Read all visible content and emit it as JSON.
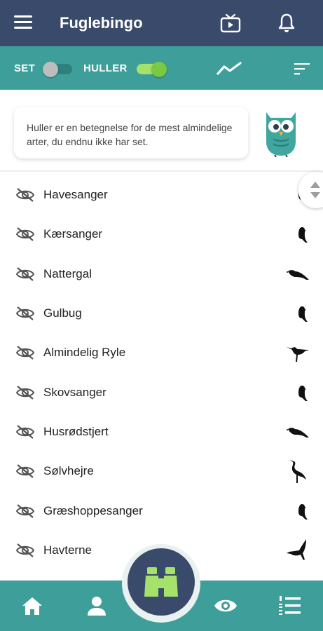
{
  "app": {
    "title": "Fuglebingo"
  },
  "filters": {
    "seen_label": "SET",
    "seen_on": false,
    "gaps_label": "HULLER",
    "gaps_on": true
  },
  "info": {
    "text": "Huller er en betegnelse for de mest almindelige arter, du endnu ikke har set."
  },
  "birds": [
    {
      "name": "Havesanger",
      "icon": "songbird-silhouette"
    },
    {
      "name": "Kærsanger",
      "icon": "songbird-silhouette"
    },
    {
      "name": "Nattergal",
      "icon": "thrush-silhouette"
    },
    {
      "name": "Gulbug",
      "icon": "songbird-silhouette"
    },
    {
      "name": "Almindelig Ryle",
      "icon": "wader-silhouette"
    },
    {
      "name": "Skovsanger",
      "icon": "songbird-silhouette"
    },
    {
      "name": "Husrødstjert",
      "icon": "thrush-silhouette"
    },
    {
      "name": "Sølvhejre",
      "icon": "heron-silhouette"
    },
    {
      "name": "Græshoppesanger",
      "icon": "songbird-silhouette"
    },
    {
      "name": "Havterne",
      "icon": "tern-silhouette"
    }
  ],
  "colors": {
    "appbar": "#3a4a6b",
    "accent": "#3e9e9a",
    "toggle_on": "#7ac943",
    "fab_icon": "#a6e26b"
  }
}
